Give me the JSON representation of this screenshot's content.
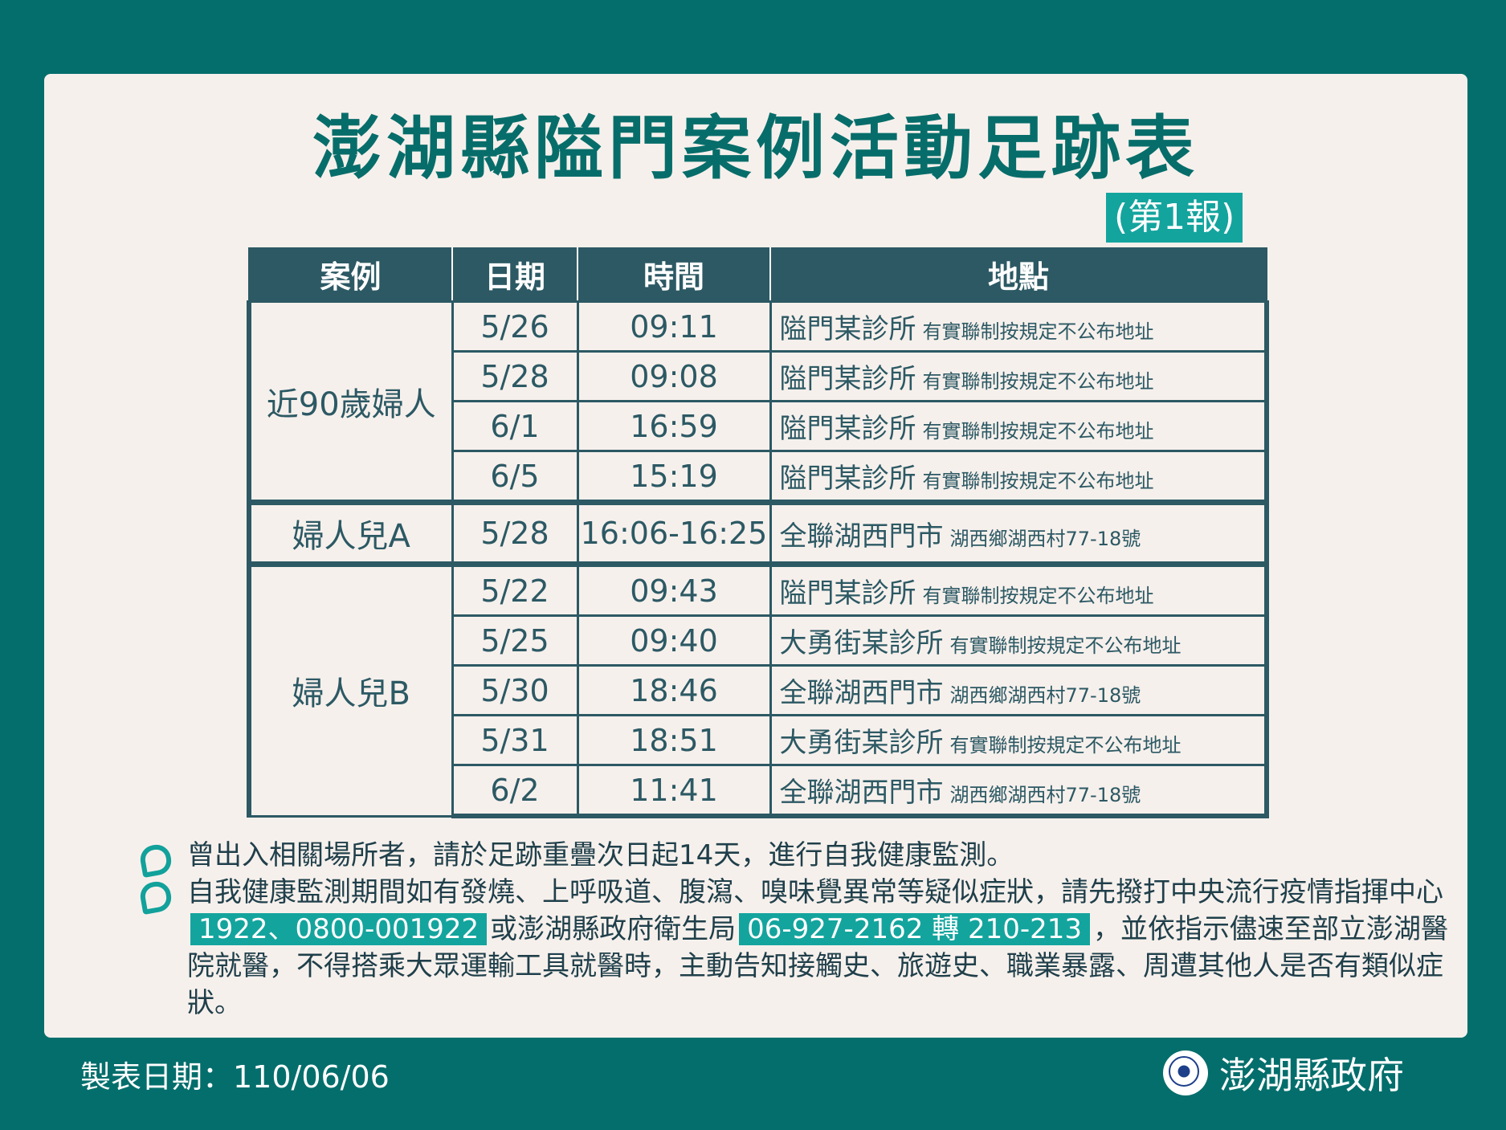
{
  "title": "澎湖縣隘門案例活動足跡表",
  "report": "(第1報)",
  "table": {
    "headers": [
      "案例",
      "日期",
      "時間",
      "地點"
    ],
    "groups": [
      {
        "case": "近90歲婦人",
        "rows": [
          {
            "date": "5/26",
            "time": "09:11",
            "place": "隘門某診所",
            "note": "有實聯制按規定不公布地址"
          },
          {
            "date": "5/28",
            "time": "09:08",
            "place": "隘門某診所",
            "note": "有實聯制按規定不公布地址"
          },
          {
            "date": "6/1",
            "time": "16:59",
            "place": "隘門某診所",
            "note": "有實聯制按規定不公布地址"
          },
          {
            "date": "6/5",
            "time": "15:19",
            "place": "隘門某診所",
            "note": "有實聯制按規定不公布地址"
          }
        ]
      },
      {
        "case": "婦人兒A",
        "rows": [
          {
            "date": "5/28",
            "time": "16:06-16:25",
            "place": "全聯湖西門市",
            "note": "湖西鄉湖西村77-18號"
          }
        ]
      },
      {
        "case": "婦人兒B",
        "rows": [
          {
            "date": "5/22",
            "time": "09:43",
            "place": "隘門某診所",
            "note": "有實聯制按規定不公布地址"
          },
          {
            "date": "5/25",
            "time": "09:40",
            "place": "大勇街某診所",
            "note": "有實聯制按規定不公布地址"
          },
          {
            "date": "5/30",
            "time": "18:46",
            "place": "全聯湖西門市",
            "note": "湖西鄉湖西村77-18號"
          },
          {
            "date": "5/31",
            "time": "18:51",
            "place": "大勇街某診所",
            "note": "有實聯制按規定不公布地址"
          },
          {
            "date": "6/2",
            "time": "11:41",
            "place": "全聯湖西門市",
            "note": "湖西鄉湖西村77-18號"
          }
        ]
      }
    ]
  },
  "notes": {
    "item1": "曾出入相關場所者，請於足跡重疊次日起14天，進行自我健康監測。",
    "item2_part1": "自我健康監測期間如有發燒、上呼吸道、腹瀉、嗅味覺異常等疑似症狀，請先撥打中央流行疫情指揮中心",
    "hotline": "1922、0800-001922",
    "item2_part2": "或澎湖縣政府衛生局",
    "phone": "06-927-2162 轉 210-213",
    "item2_part3": "，並依指示儘速至部立澎湖醫院就醫，不得搭乘大眾運輸工具就醫時，主動告知接觸史、旅遊史、職業暴露、周遭其他人是否有類似症狀。"
  },
  "footer": {
    "date": "製表日期：110/06/06",
    "org": "澎湖縣政府"
  },
  "colors": {
    "background": "#046e6c",
    "card": "#f6f0ec",
    "title": "#076d6a",
    "table_header": "#2c5964",
    "highlight": "#14a49e"
  }
}
